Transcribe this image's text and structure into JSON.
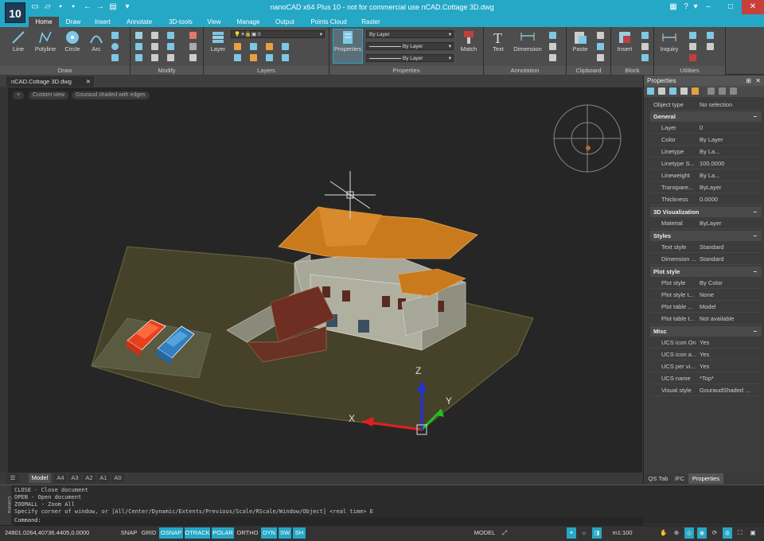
{
  "window": {
    "title": "nanoCAD x64 Plus 10 - not for commercial use nCAD.Cottage 3D.dwg",
    "app_icon": "10",
    "help": "?",
    "minimize": "–",
    "maximize": "□",
    "close": "✕"
  },
  "ribbon_tabs": [
    "Home",
    "Draw",
    "Insert",
    "Annotate",
    "3D-tools",
    "View",
    "Manage",
    "Output",
    "Points Cloud",
    "Raster"
  ],
  "panels": {
    "draw": "Draw",
    "modify": "Modify",
    "layers": "Layers",
    "properties": "Properties",
    "annotation": "Annotation",
    "clipboard": "Clipboard",
    "block": "Block",
    "utilities": "Utilities"
  },
  "buttons": {
    "line": "Line",
    "polyline": "Polyline",
    "circle": "Circle",
    "arc": "Arc",
    "layer": "Layer",
    "properties": "Properties",
    "match": "Match",
    "text": "Text",
    "dimension": "Dimension",
    "paste": "Paste",
    "insert": "Insert",
    "inquiry": "Inquiry"
  },
  "layer_combo": "0",
  "prop_combos": [
    "By Layer",
    "By Layer",
    "By Layer"
  ],
  "doc_tab": "nCAD.Cottage 3D.dwg",
  "doc_tab_close": "✕",
  "viewport": {
    "chip_plus": "+",
    "chip_view": "Custom view",
    "chip_style": "Gouraud shaded with edges",
    "axis_x": "X",
    "axis_y": "Y",
    "axis_z": "Z"
  },
  "layout_tabs": [
    "Model",
    "A4",
    "A3",
    "A2",
    "A1",
    "A0"
  ],
  "command": {
    "side": "Comma",
    "lines": [
      "CLOSE - Close document",
      "OPEN - Open document",
      "ZOOMALL - Zoom All",
      "Specify corner of window, or [All/Center/Dynamic/Extents/Previous/Scale/RScale/Window/Object] <real time> E"
    ],
    "prompt": "Command:"
  },
  "status": {
    "coords": "24801.0264,40736.4405,0.0000",
    "toggles": [
      {
        "label": "SNAP",
        "on": false
      },
      {
        "label": "GRID",
        "on": false
      },
      {
        "label": "OSNAP",
        "on": true
      },
      {
        "label": "OTRACK",
        "on": true
      },
      {
        "label": "POLAR",
        "on": true
      },
      {
        "label": "ORTHO",
        "on": false
      },
      {
        "label": "DYN",
        "on": true
      },
      {
        "label": "SW",
        "on": true
      },
      {
        "label": "SH",
        "on": true
      }
    ],
    "model": "MODEL",
    "scale": "m1:100"
  },
  "properties": {
    "title": "Properties",
    "pin": "⊞",
    "close": "✕",
    "object_type_label": "Object type",
    "object_type_value": "No selection",
    "sections": [
      {
        "name": "General",
        "rows": [
          [
            "Layer",
            "0"
          ],
          [
            "Color",
            "By Layer"
          ],
          [
            "Linetype",
            "By La..."
          ],
          [
            "Linetype S...",
            "100.0000"
          ],
          [
            "Lineweight",
            "By La..."
          ],
          [
            "Transpare...",
            "ByLayer"
          ],
          [
            "Thickness",
            "0.0000"
          ]
        ]
      },
      {
        "name": "3D Visualization",
        "rows": [
          [
            "Material",
            "ByLayer"
          ]
        ]
      },
      {
        "name": "Styles",
        "rows": [
          [
            "Text style",
            "Standard"
          ],
          [
            "Dimension ...",
            "Standard"
          ]
        ]
      },
      {
        "name": "Plot style",
        "rows": [
          [
            "Plot style",
            "By Color"
          ],
          [
            "Plot style t...",
            "None"
          ],
          [
            "Plot table ...",
            "Model"
          ],
          [
            "Plot table t...",
            "Not available"
          ]
        ]
      },
      {
        "name": "Misc",
        "rows": [
          [
            "UCS icon On",
            "Yes"
          ],
          [
            "UCS icon a...",
            "Yes"
          ],
          [
            "UCS per vi...",
            "Yes"
          ],
          [
            "UCS name",
            "*Top*"
          ],
          [
            "Visual style",
            "GouraudShaded ..."
          ]
        ]
      }
    ],
    "bottom_tabs": [
      "QS Tab",
      "IFC",
      "Properties"
    ]
  },
  "colors": {
    "accent": "#25a7c6",
    "roof": "#c97a1c",
    "car_red": "#e8401d",
    "car_blue": "#2f7fc1",
    "ground": "#5a5a3a"
  }
}
